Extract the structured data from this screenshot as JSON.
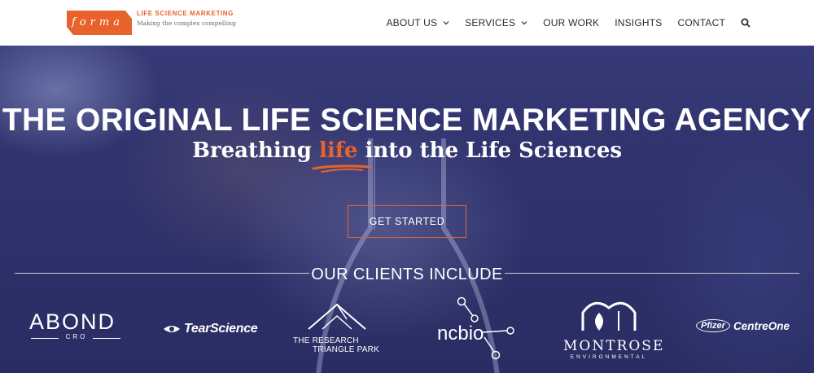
{
  "brand": {
    "logo_text": "forma",
    "tagline_title": "LIFE SCIENCE MARKETING",
    "tagline_sub": "Making the complex compelling",
    "accent_color": "#e8622c"
  },
  "nav": {
    "items": [
      {
        "label": "ABOUT US",
        "has_dropdown": true
      },
      {
        "label": "SERVICES",
        "has_dropdown": true
      },
      {
        "label": "OUR WORK",
        "has_dropdown": false
      },
      {
        "label": "INSIGHTS",
        "has_dropdown": false
      },
      {
        "label": "CONTACT",
        "has_dropdown": false
      }
    ],
    "search_icon": "search-icon"
  },
  "hero": {
    "headline": "THE ORIGINAL LIFE SCIENCE MARKETING AGENCY",
    "sub_before": "Breathing ",
    "sub_accent": "life",
    "sub_after": " into the Life Sciences",
    "cta_label": "GET STARTED"
  },
  "clients": {
    "title": "OUR CLIENTS INCLUDE",
    "abond": {
      "name": "ABOND",
      "sub": "CRO"
    },
    "tearscience": {
      "name": "TearScience"
    },
    "rtp": {
      "line1": "THE RESEARCH",
      "line2": "TRIANGLE PARK"
    },
    "ncbio": {
      "name": "ncbio"
    },
    "montrose": {
      "name": "MONTROSE",
      "sub": "ENVIRONMENTAL"
    },
    "pfizer": {
      "badge": "Pfizer",
      "name": "CentreOne"
    }
  }
}
